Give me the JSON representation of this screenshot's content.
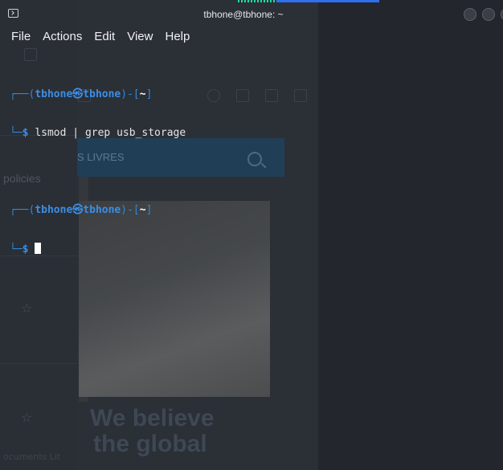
{
  "window": {
    "title": "tbhone@tbhone: ~"
  },
  "menu": {
    "items": [
      "File",
      "Actions",
      "Edit",
      "View",
      "Help"
    ]
  },
  "terminal": {
    "prompt_user": "tbhone",
    "prompt_host": "tbhone",
    "prompt_at_symbol": "㉿",
    "prompt_dir": "~",
    "prompt_symbol": "$",
    "history": [
      {
        "command_parts": [
          "lsmod",
          "|",
          "grep",
          "usb_storage"
        ]
      }
    ],
    "current_input": ""
  },
  "background_app": {
    "banner_text": "S LIVRES",
    "side_text": "policies",
    "headline_line1": "We believe",
    "headline_line2": "the global",
    "footer_text": "ocuments Lit"
  },
  "colors": {
    "terminal_bg": "#23262d",
    "prompt_blue": "#3b8ee6",
    "indicator_green": "#19e0a0",
    "indicator_blue": "#2f6ef0"
  },
  "icons": {
    "app_icon": "terminal-icon",
    "window_buttons": [
      "minimize-icon",
      "maximize-icon",
      "close-icon"
    ]
  }
}
